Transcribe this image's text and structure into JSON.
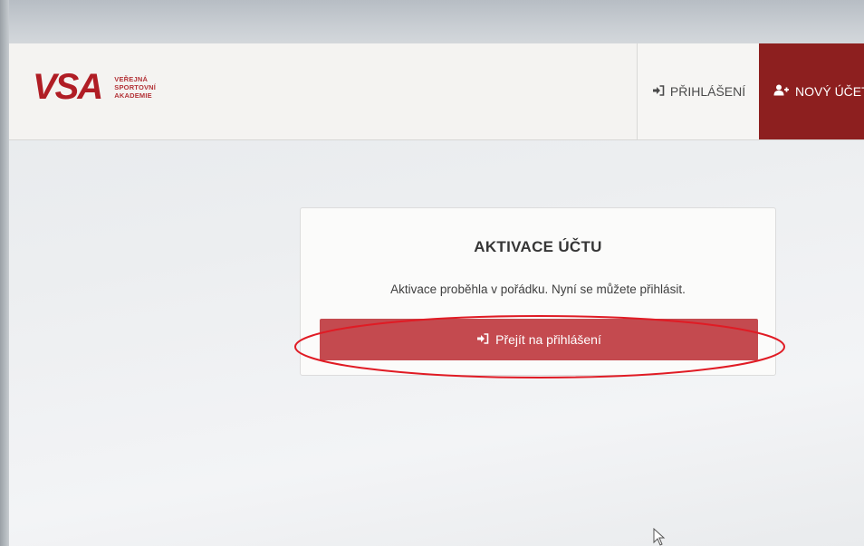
{
  "header": {
    "logo_mark": "VSA",
    "logo_lines": [
      "VEŘEJNÁ",
      "SPORTOVNÍ",
      "AKADEMIE"
    ],
    "nav": {
      "login_label": "PŘIHLÁŠENÍ",
      "login_icon": "sign-in-icon",
      "register_label": "NOVÝ ÚČET",
      "register_icon": "user-plus-icon"
    }
  },
  "card": {
    "title": "AKTIVACE ÚČTU",
    "message": "Aktivace proběhla v pořádku. Nyní se můžete přihlásit.",
    "button_label": "Přejít na přihlášení",
    "button_icon": "sign-in-icon"
  },
  "colors": {
    "brand": "#b01d25",
    "register_bg": "#8d1f1f",
    "button_bg": "#c44a4f",
    "annotation": "#e01b24"
  }
}
